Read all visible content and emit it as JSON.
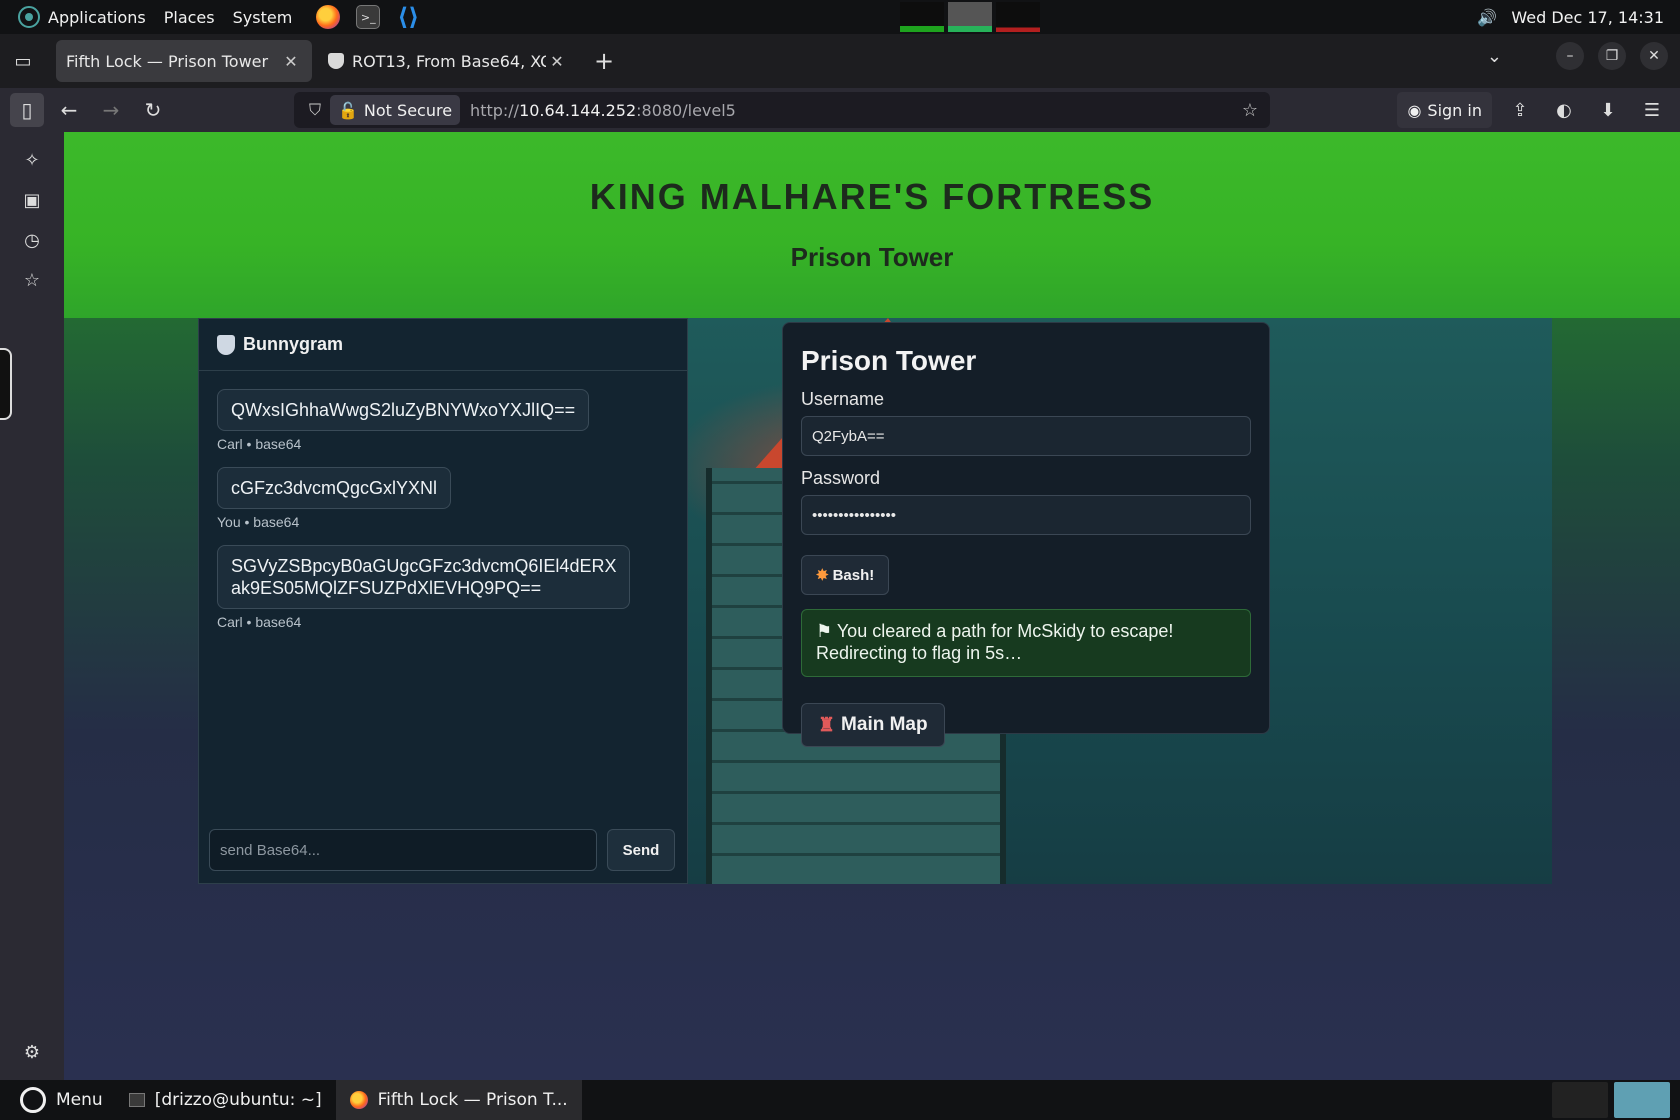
{
  "system_panel": {
    "applications": "Applications",
    "places": "Places",
    "system": "System",
    "datetime": "Wed Dec 17, 14:31"
  },
  "tabs": [
    {
      "title": "Fifth Lock — Prison Tower",
      "active": true
    },
    {
      "title": "ROT13, From Base64, XO",
      "active": false
    }
  ],
  "navbar": {
    "security_label": "Not Secure",
    "url_prefix": "http://",
    "url_host": "10.64.144.252",
    "url_rest": ":8080/level5",
    "signin": "Sign in",
    "notification_badge": "0"
  },
  "page": {
    "title": "KING MALHARE'S FORTRESS",
    "subtitle": "Prison Tower"
  },
  "chat": {
    "header": "Bunnygram",
    "messages": [
      {
        "text": "QWxsIGhhaWwgS2luZyBNYWxoYXJlIQ==",
        "meta": "Carl • base64"
      },
      {
        "text": "cGFzc3dvcmQgcGxlYXNl",
        "meta": "You • base64"
      },
      {
        "text": "SGVyZSBpcyB0aGUgcGFzc3dvcmQ6IEl4dERX\nak9ES05MQlZFSUZPdXlEVHQ9PQ==",
        "meta": "Carl • base64"
      }
    ],
    "input_placeholder": "send Base64...",
    "send_label": "Send"
  },
  "login": {
    "title": "Prison Tower",
    "username_label": "Username",
    "username_value": "Q2FybA==",
    "password_label": "Password",
    "password_value": "••••••••••••••••",
    "bash_label": "Bash!",
    "status": "You cleared a path for McSkidy to escape!\nRedirecting to flag in 5s…",
    "main_map_label": "Main Map"
  },
  "taskbar": {
    "menu": "Menu",
    "terminal": "[drizzo@ubuntu: ~]",
    "firefox": "Fifth Lock — Prison T..."
  },
  "colors": {
    "hero_green": "#37b326",
    "status_green": "#173a1f",
    "card_bg": "#141e28"
  }
}
